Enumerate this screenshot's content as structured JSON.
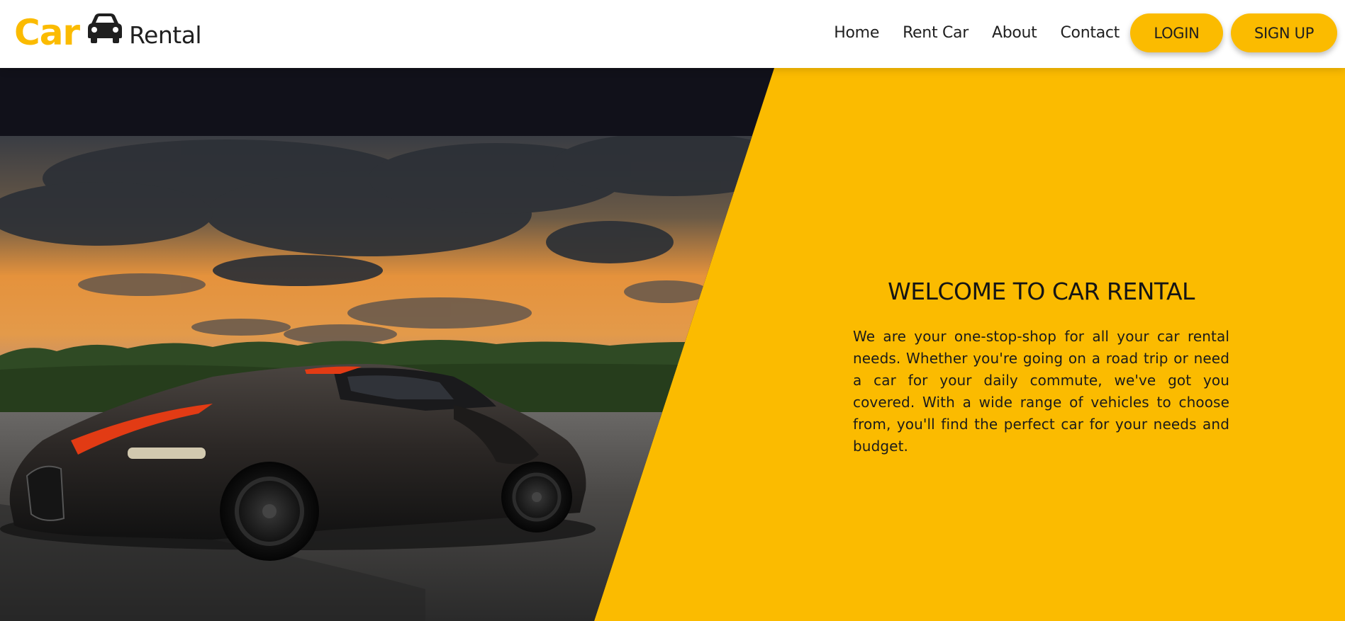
{
  "brand": {
    "logo_primary": "Car",
    "logo_secondary": "Rental",
    "icon": "car-icon",
    "accent_color": "#fbbb00"
  },
  "nav": {
    "links": [
      "Home",
      "Rent Car",
      "About",
      "Contact"
    ],
    "login_label": "LOGIN",
    "signup_label": "SIGN UP"
  },
  "hero": {
    "title": "WELCOME TO CAR RENTAL",
    "description": "We are your one-stop-shop for all your car rental needs. Whether you're going on a road trip or need a car for your daily commute, we've got you covered. With a wide range of vehicles to choose from, you'll find the perfect car for your needs and budget.",
    "image": "sports-car-sunset-photo"
  }
}
